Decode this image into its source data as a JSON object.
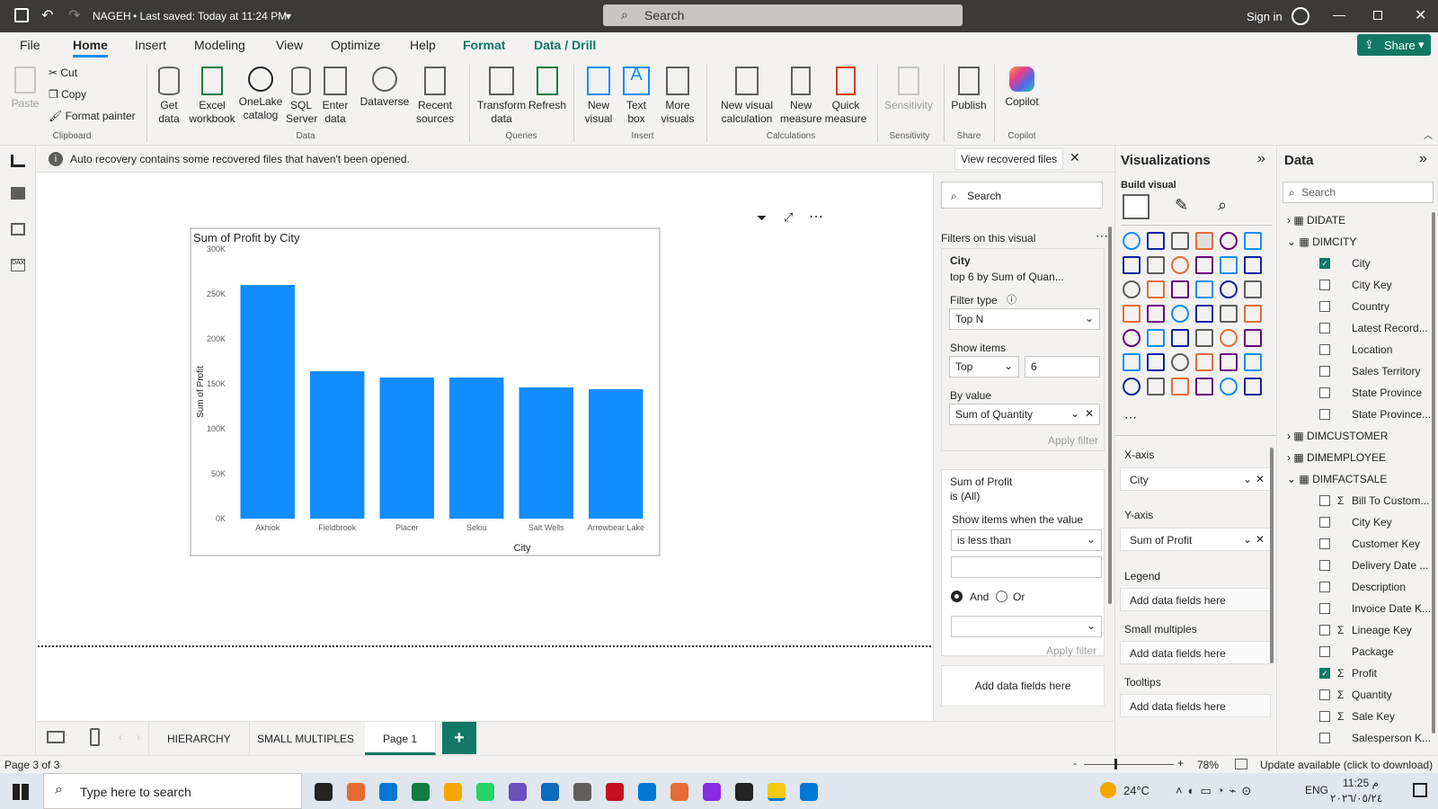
{
  "titlebar": {
    "file_name": "NAGEH",
    "save_status": "• Last saved: Today at 11:24 PM",
    "search_placeholder": "Search",
    "sign_in": "Sign in"
  },
  "menu": {
    "items": [
      "File",
      "Home",
      "Insert",
      "Modeling",
      "View",
      "Optimize",
      "Help",
      "Format",
      "Data / Drill"
    ],
    "share": "Share"
  },
  "ribbon": {
    "clipboard": {
      "paste": "Paste",
      "cut": "Cut",
      "copy": "Copy",
      "format_painter": "Format painter",
      "group": "Clipboard"
    },
    "data": {
      "items": [
        "Get data",
        "Excel workbook",
        "OneLake catalog",
        "SQL Server",
        "Enter data",
        "Dataverse",
        "Recent sources"
      ],
      "group": "Data"
    },
    "queries": {
      "items": [
        "Transform data",
        "Refresh"
      ],
      "group": "Queries"
    },
    "insert": {
      "items": [
        "New visual",
        "Text box",
        "More visuals"
      ],
      "group": "Insert"
    },
    "calculations": {
      "items": [
        "New visual calculation",
        "New measure",
        "Quick measure"
      ],
      "group": "Calculations"
    },
    "sensitivity": {
      "items": [
        "Sensitivity"
      ],
      "group": "Sensitivity"
    },
    "share": {
      "items": [
        "Publish"
      ],
      "group": "Share"
    },
    "copilot": {
      "items": [
        "Copilot"
      ],
      "group": "Copilot"
    }
  },
  "notification": {
    "text": "Auto recovery contains some recovered files that haven't been opened.",
    "action": "View recovered files"
  },
  "chart_data": {
    "type": "bar",
    "title": "Sum of Profit by City",
    "xlabel": "City",
    "ylabel": "Sum of Profit",
    "categories": [
      "Akhiok",
      "Fieldbrook",
      "Placer",
      "Sekiu",
      "Salt Wells",
      "Arrowbear Lake"
    ],
    "values": [
      260000,
      164000,
      157000,
      157000,
      146000,
      144000
    ],
    "ylim": [
      0,
      300000
    ],
    "yticks": [
      "0K",
      "50K",
      "100K",
      "150K",
      "200K",
      "250K",
      "300K"
    ],
    "color": "#118dff",
    "grid": false
  },
  "filters": {
    "search": "Search",
    "section": "Filters on this visual",
    "card1": {
      "field": "City",
      "summary": "top 6 by Sum of Quan...",
      "filter_type_label": "Filter type",
      "filter_type": "Top N",
      "show_items_label": "Show items",
      "show_dir": "Top",
      "show_count": "6",
      "by_value_label": "By value",
      "by_value": "Sum of Quantity",
      "apply": "Apply filter"
    },
    "card2": {
      "field": "Sum of Profit",
      "summary": "is (All)",
      "cond_label": "Show items when the value",
      "cond": "is less than",
      "and": "And",
      "or": "Or",
      "apply": "Apply filter"
    },
    "add_fields": "Add data fields here"
  },
  "viz": {
    "title": "Visualizations",
    "build": "Build visual",
    "wells": {
      "x_label": "X-axis",
      "x_value": "City",
      "y_label": "Y-axis",
      "y_value": "Sum of Profit",
      "legend": "Legend",
      "small_multiples": "Small multiples",
      "tooltips": "Tooltips",
      "add": "Add data fields here"
    }
  },
  "data": {
    "title": "Data",
    "search": "Search",
    "tables": [
      "DIDATE",
      "DIMCITY",
      "DIMCUSTOMER",
      "DIMEMPLOYEE",
      "DIMFACTSALE"
    ],
    "dimcity_fields": [
      "City",
      "City Key",
      "Country",
      "Latest Record...",
      "Location",
      "Sales Territory",
      "State Province",
      "State Province..."
    ],
    "fact_fields": [
      "Bill To Custom...",
      "City Key",
      "Customer Key",
      "Delivery Date ...",
      "Description",
      "Invoice Date K...",
      "Lineage Key",
      "Package",
      "Profit",
      "Quantity",
      "Sale Key",
      "Salesperson K..."
    ]
  },
  "pages": {
    "tabs": [
      "HIERARCHY",
      "SMALL MULTIPLES",
      "Page 1"
    ],
    "add": "+"
  },
  "status": {
    "page": "Page 3 of 3",
    "zoom": "78%",
    "update": "Update available (click to download)"
  },
  "taskbar": {
    "search": "Type here to search",
    "temp": "24°C",
    "lang": "ENG",
    "time": "11:25 م",
    "date": "٢٠٢٦/٠٥/٢٤"
  }
}
